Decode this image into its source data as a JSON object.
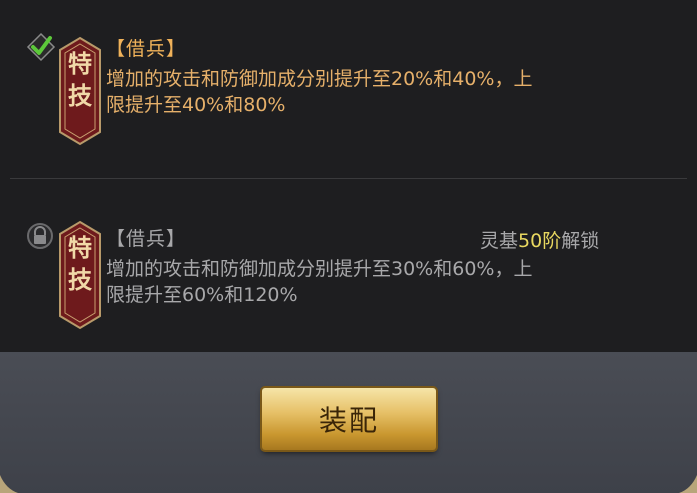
{
  "skills": [
    {
      "status": "check-icon",
      "badge": "特技",
      "name": "【借兵】",
      "description": "增加的攻击和防御加成分别提升至20%和40%，上限提升至40%和80%",
      "desc_line1": "增加的攻击和防御加成分别提升至20%和40%，上",
      "desc_line2": "限提升至40%和80%"
    },
    {
      "status": "lock-icon",
      "badge": "特技",
      "name": "【借兵】",
      "desc_line1": "增加的攻击和防御加成分别提升至30%和60%，上",
      "desc_line2": "限提升至60%和120%",
      "unlock_prefix": "灵基",
      "unlock_level": "50阶",
      "unlock_suffix": "解锁"
    }
  ],
  "equip_button_label": "装配",
  "colors": {
    "active_text": "#e6b06a",
    "locked_text": "#a8a8aa",
    "highlight": "#e8d860",
    "badge_red": "#7a1e1e"
  }
}
